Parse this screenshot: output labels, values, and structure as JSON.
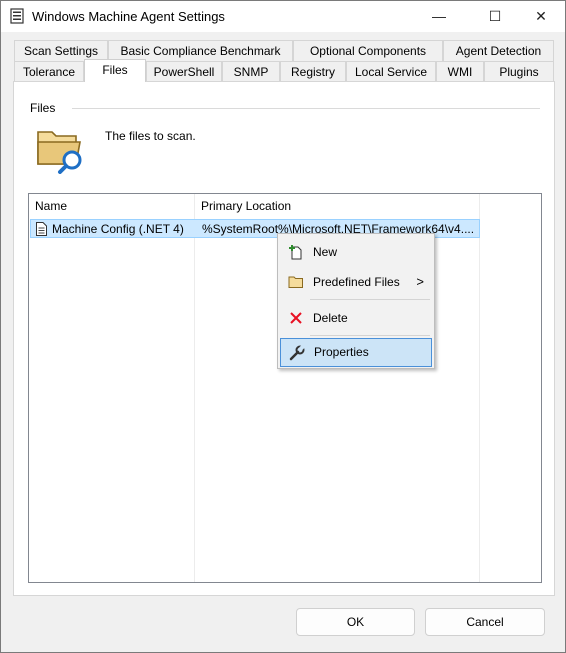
{
  "window": {
    "title": "Windows Machine Agent Settings",
    "controls": {
      "minimize": "—",
      "maximize": "☐",
      "close": "✕"
    }
  },
  "tabs": {
    "row_back": [
      "Scan Settings",
      "Basic Compliance Benchmark",
      "Optional Components",
      "Agent Detection"
    ],
    "row_front": [
      "Tolerance",
      "Files",
      "PowerShell",
      "SNMP",
      "Registry",
      "Local Service",
      "WMI",
      "Plugins"
    ],
    "active": "Files"
  },
  "files_panel": {
    "group_label": "Files",
    "description": "The files to scan.",
    "columns": [
      "Name",
      "Primary Location"
    ],
    "rows": [
      {
        "name": "Machine Config (.NET 4)",
        "location": "%SystemRoot%\\Microsoft.NET\\Framework64\\v4...."
      }
    ]
  },
  "context_menu": {
    "items": [
      {
        "label": "New",
        "icon": "new-icon"
      },
      {
        "label": "Predefined Files",
        "icon": "folder-icon",
        "submenu_arrow": ">"
      },
      {
        "label": "Delete",
        "icon": "delete-icon"
      },
      {
        "label": "Properties",
        "icon": "wrench-icon",
        "highlighted": true
      }
    ]
  },
  "footer": {
    "ok_label": "OK",
    "cancel_label": "Cancel"
  },
  "colors": {
    "selection_bg": "#cce8ff",
    "menu_highlight": "#cce4f7",
    "delete_red": "#e81123",
    "new_green": "#2e8b2e",
    "folder_fill": "#e8c77a",
    "search_blue": "#1f6fc5"
  }
}
